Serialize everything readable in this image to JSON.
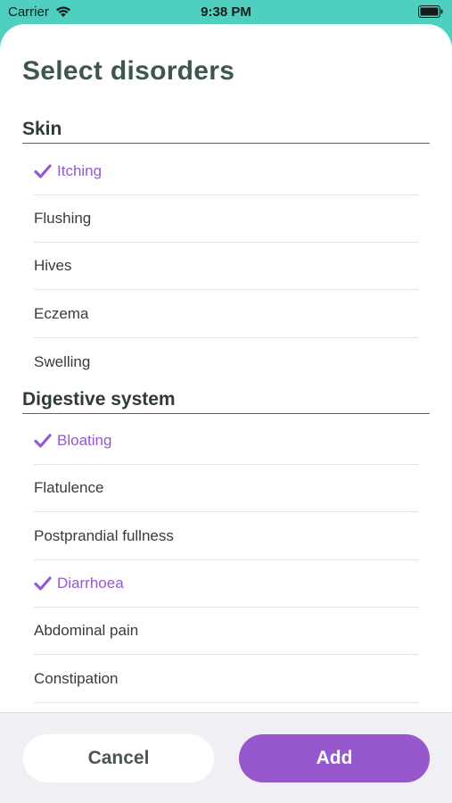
{
  "status_bar": {
    "carrier": "Carrier",
    "time": "9:38 PM"
  },
  "title": "Select disorders",
  "accent_color": "#9658cc",
  "sections": [
    {
      "header": "Skin",
      "items": [
        {
          "label": "Itching",
          "selected": true
        },
        {
          "label": "Flushing",
          "selected": false
        },
        {
          "label": "Hives",
          "selected": false
        },
        {
          "label": "Eczema",
          "selected": false
        },
        {
          "label": "Swelling",
          "selected": false
        }
      ]
    },
    {
      "header": "Digestive system",
      "items": [
        {
          "label": "Bloating",
          "selected": true
        },
        {
          "label": "Flatulence",
          "selected": false
        },
        {
          "label": "Postprandial fullness",
          "selected": false
        },
        {
          "label": "Diarrhoea",
          "selected": true
        },
        {
          "label": "Abdominal pain",
          "selected": false
        },
        {
          "label": "Constipation",
          "selected": false
        }
      ]
    }
  ],
  "footer": {
    "cancel_label": "Cancel",
    "add_label": "Add"
  }
}
